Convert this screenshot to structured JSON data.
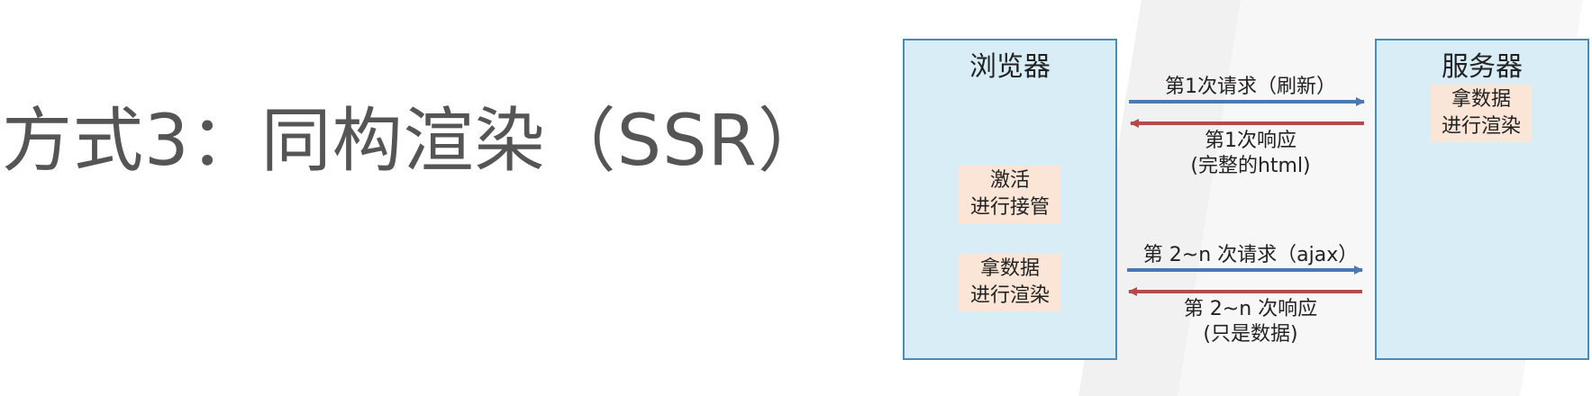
{
  "slide": {
    "title": "方式3：同构渲染（SSR）"
  },
  "browser": {
    "title": "浏览器",
    "notes": [
      {
        "line1": "激活",
        "line2": "进行接管"
      },
      {
        "line1": "拿数据",
        "line2": "进行渲染"
      }
    ]
  },
  "server": {
    "title": "服务器",
    "note": {
      "line1": "拿数据",
      "line2": "进行渲染"
    }
  },
  "messages": {
    "request1": {
      "line1": "第1次请求（刷新）"
    },
    "response1": {
      "line1": "第1次响应",
      "line2": "(完整的html)"
    },
    "requestN": {
      "line1": "第 2~n 次请求（ajax）"
    },
    "responseN": {
      "line1": "第 2~n 次响应",
      "line2": "(只是数据)"
    }
  },
  "colors": {
    "request_arrow": "#4a78b5",
    "response_arrow": "#b54a4a",
    "panel_fill": "#d9edf6",
    "note_fill": "#fbe5d6"
  }
}
